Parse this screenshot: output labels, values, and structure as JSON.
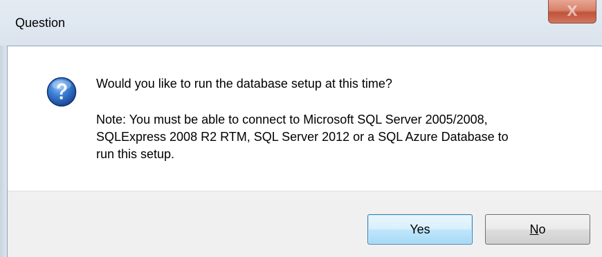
{
  "window": {
    "title": "Question",
    "close_label": "X"
  },
  "message": {
    "main": "Would you like to run the database setup at this time?",
    "note_lines": [
      "Note: You must be able to connect to Microsoft SQL Server 2005/2008,",
      "SQLExpress 2008 R2 RTM, SQL Server 2012 or a SQL Azure Database to",
      "run this setup."
    ]
  },
  "buttons": {
    "yes_label": "Yes",
    "no_mnemonic": "N",
    "no_rest": "o"
  },
  "icons": {
    "question": "question-icon",
    "close": "close-icon"
  },
  "colors": {
    "icon_blue": "#1f5fb0",
    "close_red": "#c0533a",
    "default_button_border": "#3c7fb1"
  }
}
